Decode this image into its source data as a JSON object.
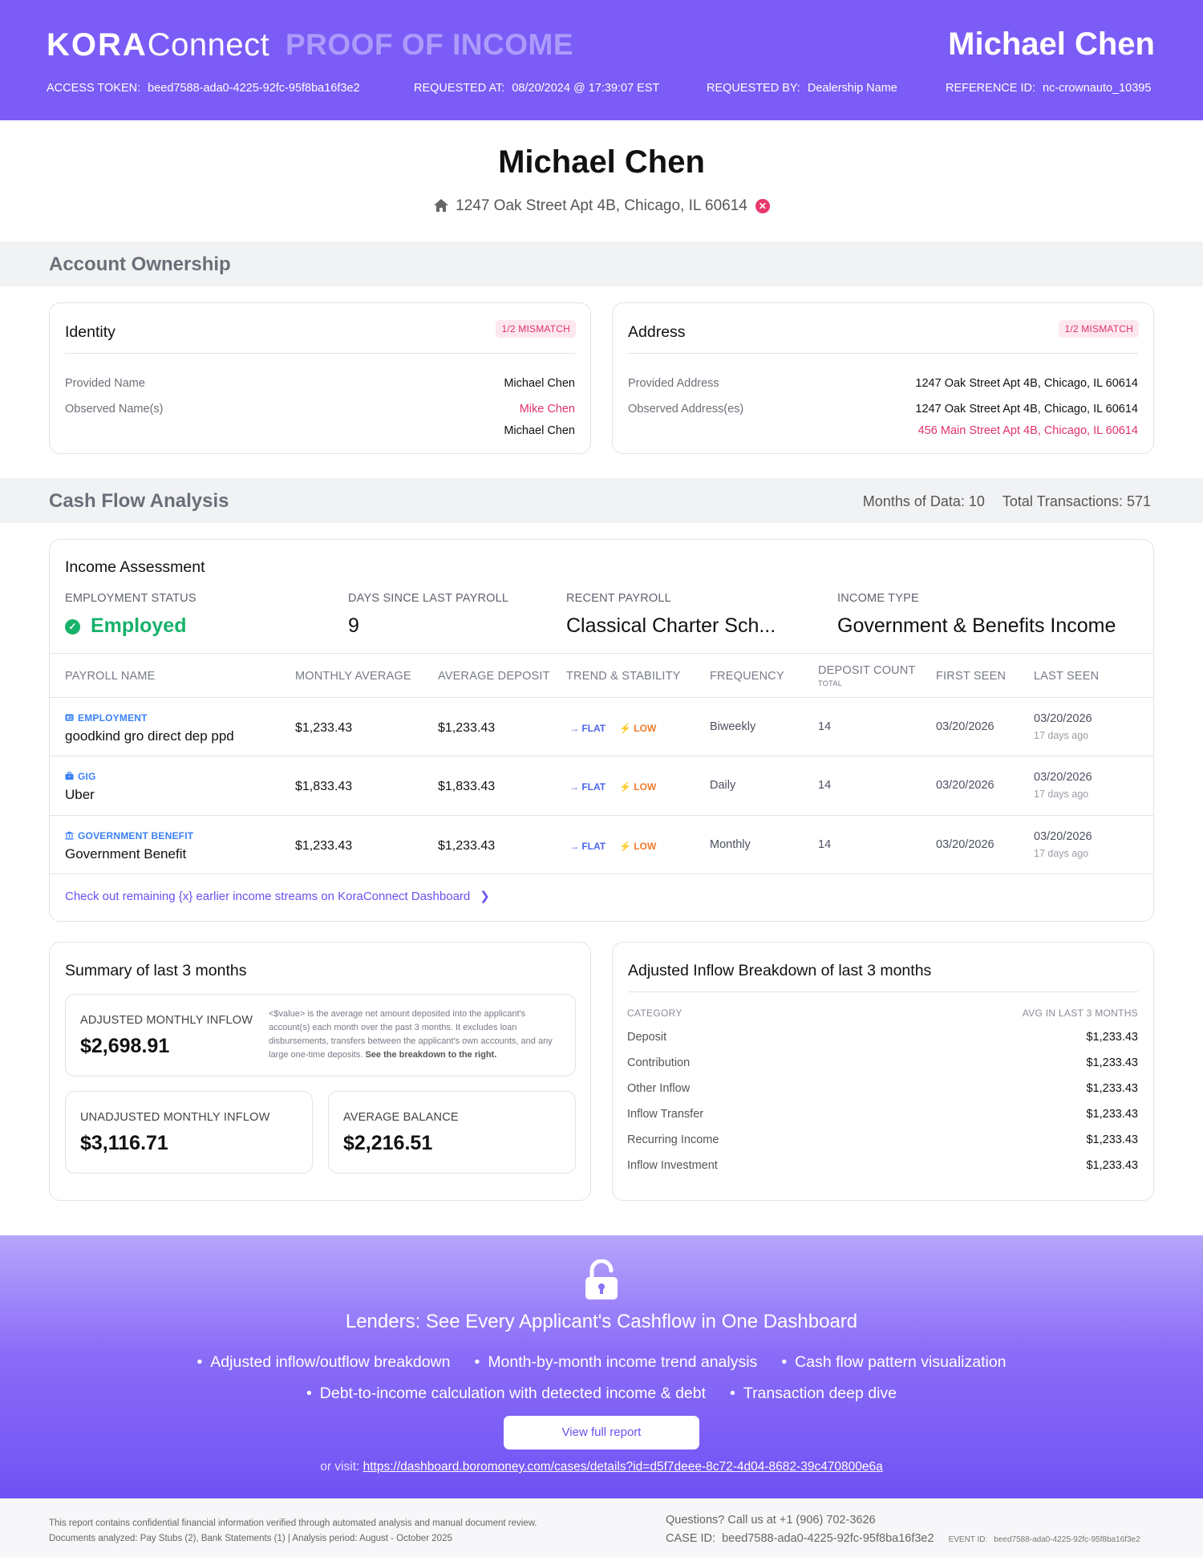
{
  "header": {
    "logo_bold": "KORA",
    "logo_light": "Connect",
    "doc_title": "PROOF OF INCOME",
    "applicant_name": "Michael Chen",
    "meta": [
      {
        "label": "ACCESS TOKEN:",
        "value": "beed7588-ada0-4225-92fc-95f8ba16f3e2"
      },
      {
        "label": "REQUESTED AT:",
        "value": "08/20/2024 @ 17:39:07 EST"
      },
      {
        "label": "REQUESTED BY:",
        "value": "Dealership Name"
      },
      {
        "label": "REFERENCE ID:",
        "value": "nc-crownauto_10395"
      }
    ]
  },
  "applicant": {
    "name": "Michael Chen",
    "address": "1247 Oak Street Apt 4B, Chicago, IL 60614",
    "home_icon": "home-icon",
    "status_icon": "close-circle-icon"
  },
  "account_ownership": {
    "title": "Account Ownership",
    "identity": {
      "title": "Identity",
      "badge": "1/2 MISMATCH",
      "provided_label": "Provided Name",
      "provided_value": "Michael Chen",
      "observed_label": "Observed Name(s)",
      "observed_values": [
        "Mike Chen",
        "Michael Chen"
      ]
    },
    "address": {
      "title": "Address",
      "badge": "1/2 MISMATCH",
      "provided_label": "Provided Address",
      "provided_value": "1247 Oak Street Apt 4B, Chicago, IL 60614",
      "observed_label": "Observed Address(es)",
      "observed_values": [
        "1247 Oak Street Apt 4B, Chicago, IL 60614",
        "456 Main Street Apt 4B, Chicago, IL 60614"
      ]
    }
  },
  "cash_flow": {
    "title": "Cash Flow Analysis",
    "months": "Months of Data: 10",
    "transactions": "Total Transactions: 571"
  },
  "income_assessment": {
    "title": "Income Assessment",
    "employment_status_label": "EMPLOYMENT STATUS",
    "employment_status": "Employed",
    "days_label": "DAYS SINCE LAST PAYROLL",
    "days": "9",
    "recent_payroll_label": "RECENT PAYROLL",
    "recent_payroll": "Classical Charter Sch...",
    "income_type_label": "INCOME TYPE",
    "income_type": "Government & Benefits Income",
    "columns": {
      "payroll_name": "PAYROLL NAME",
      "monthly_average": "MONTHLY AVERAGE",
      "average_deposit": "AVERAGE DEPOSIT",
      "trend": "TREND & STABILITY",
      "frequency": "FREQUENCY",
      "deposit_count": "DEPOSIT COUNT",
      "deposit_count_sub": "TOTAL",
      "first_seen": "FIRST SEEN",
      "last_seen": "LAST SEEN"
    },
    "rows": [
      {
        "type": "EMPLOYMENT",
        "icon": "id-card-icon",
        "name": "goodkind gro direct dep ppd",
        "monthly_average": "$1,233.43",
        "average_deposit": "$1,233.43",
        "trend": "FLAT",
        "stability": "LOW",
        "frequency": "Biweekly",
        "deposit_count": "14",
        "first_seen": "03/20/2026",
        "last_seen": "03/20/2026",
        "last_seen_ago": "17 days ago"
      },
      {
        "type": "GIG",
        "icon": "briefcase-icon",
        "name": "Uber",
        "monthly_average": "$1,833.43",
        "average_deposit": "$1,833.43",
        "trend": "FLAT",
        "stability": "LOW",
        "frequency": "Daily",
        "deposit_count": "14",
        "first_seen": "03/20/2026",
        "last_seen": "03/20/2026",
        "last_seen_ago": "17 days ago"
      },
      {
        "type": "GOVERNMENT BENEFIT",
        "icon": "bank-icon",
        "name": "Government Benefit",
        "monthly_average": "$1,233.43",
        "average_deposit": "$1,233.43",
        "trend": "FLAT",
        "stability": "LOW",
        "frequency": "Monthly",
        "deposit_count": "14",
        "first_seen": "03/20/2026",
        "last_seen": "03/20/2026",
        "last_seen_ago": "17 days ago"
      }
    ],
    "more_link": "Check out remaining {x} earlier income streams on KoraConnect Dashboard"
  },
  "summary": {
    "title": "Summary of last 3 months",
    "adjusted_label": "ADJUSTED MONTHLY INFLOW",
    "adjusted_value": "$2,698.91",
    "adjusted_note": "<$value> is the average net amount deposited into the applicant's account(s) each month over the past 3 months. It excludes loan disbursements, transfers between the applicant's own accounts, and any large one-time deposits.",
    "adjusted_note_bold": "See the breakdown to the right.",
    "unadjusted_label": "UNADJUSTED MONTHLY INFLOW",
    "unadjusted_value": "$3,116.71",
    "balance_label": "AVERAGE BALANCE",
    "balance_value": "$2,216.51"
  },
  "breakdown": {
    "title": "Adjusted Inflow Breakdown of last 3 months",
    "category_header": "CATEGORY",
    "avg_header": "AVG IN LAST 3 MONTHS",
    "items": [
      {
        "label": "Deposit",
        "value": "$1,233.43"
      },
      {
        "label": "Contribution",
        "value": "$1,233.43"
      },
      {
        "label": "Other Inflow",
        "value": "$1,233.43"
      },
      {
        "label": "Inflow Transfer",
        "value": "$1,233.43"
      },
      {
        "label": "Recurring Income",
        "value": "$1,233.43"
      },
      {
        "label": "Inflow Investment",
        "value": "$1,233.43"
      }
    ]
  },
  "promo": {
    "icon": "unlock-icon",
    "title": "Lenders: See Every Applicant's Cashflow in One Dashboard",
    "bullets_row1": [
      "Adjusted inflow/outflow breakdown",
      "Month-by-month income trend analysis",
      "Cash flow pattern visualization"
    ],
    "bullets_row2": [
      "Debt-to-income calculation with detected income & debt",
      "Transaction deep dive"
    ],
    "cta": "View full report",
    "visit_prefix": "or visit:",
    "visit_url": "https://dashboard.boromoney.com/cases/details?id=d5f7deee-8c72-4d04-8682-39c470800e6a"
  },
  "footer": {
    "disclaimer_1": "This report contains confidential financial information verified through automated analysis and manual document review.",
    "disclaimer_2": "Documents analyzed: Pay Stubs (2), Bank Statements (1) | Analysis period: August - October 2025",
    "questions": "Questions? Call us at",
    "phone": "+1 (906) 702-3626",
    "case_label": "CASE ID:",
    "case_id": "beed7588-ada0-4225-92fc-95f8ba16f3e2",
    "event_label": "EVENT ID:",
    "event_id": "beed7588-ada0-4225-92fc-95f8ba16f3e2"
  },
  "colors": {
    "brand": "#7b5cf6",
    "mismatch": "#e0336a",
    "employed": "#16b26a",
    "trend": "#4d67e8",
    "stability_low": "#f07a2c",
    "income_type_tag": "#3b82f6"
  }
}
